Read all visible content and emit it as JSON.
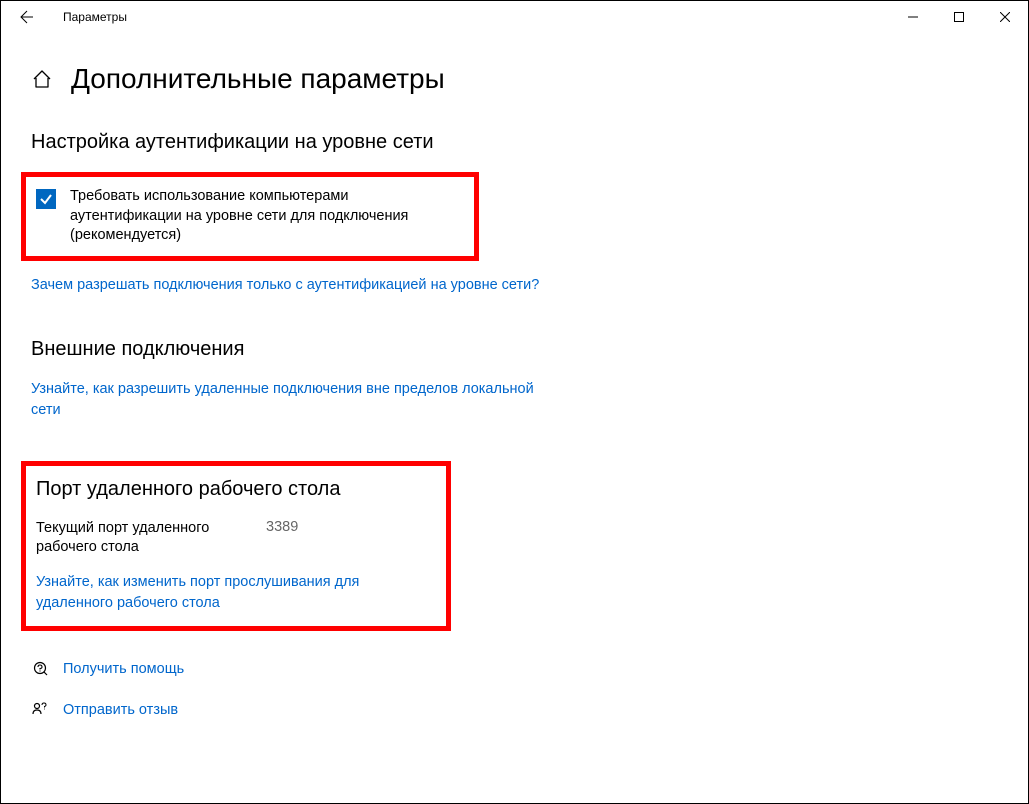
{
  "window": {
    "title": "Параметры"
  },
  "page": {
    "title": "Дополнительные параметры"
  },
  "section1": {
    "heading": "Настройка аутентификации на уровне сети",
    "checkbox_label": "Требовать использование компьютерами аутентификации на уровне сети для подключения (рекомендуется)",
    "help_link": "Зачем разрешать подключения только с аутентификацией на уровне сети?"
  },
  "section2": {
    "heading": "Внешние подключения",
    "help_link": "Узнайте, как разрешить удаленные подключения вне пределов локальной сети"
  },
  "section3": {
    "heading": "Порт удаленного рабочего стола",
    "port_label": "Текущий порт удаленного рабочего стола",
    "port_value": "3389",
    "help_link": "Узнайте, как изменить порт прослушивания для удаленного рабочего стола"
  },
  "footer": {
    "help": "Получить помощь",
    "feedback": "Отправить отзыв"
  }
}
